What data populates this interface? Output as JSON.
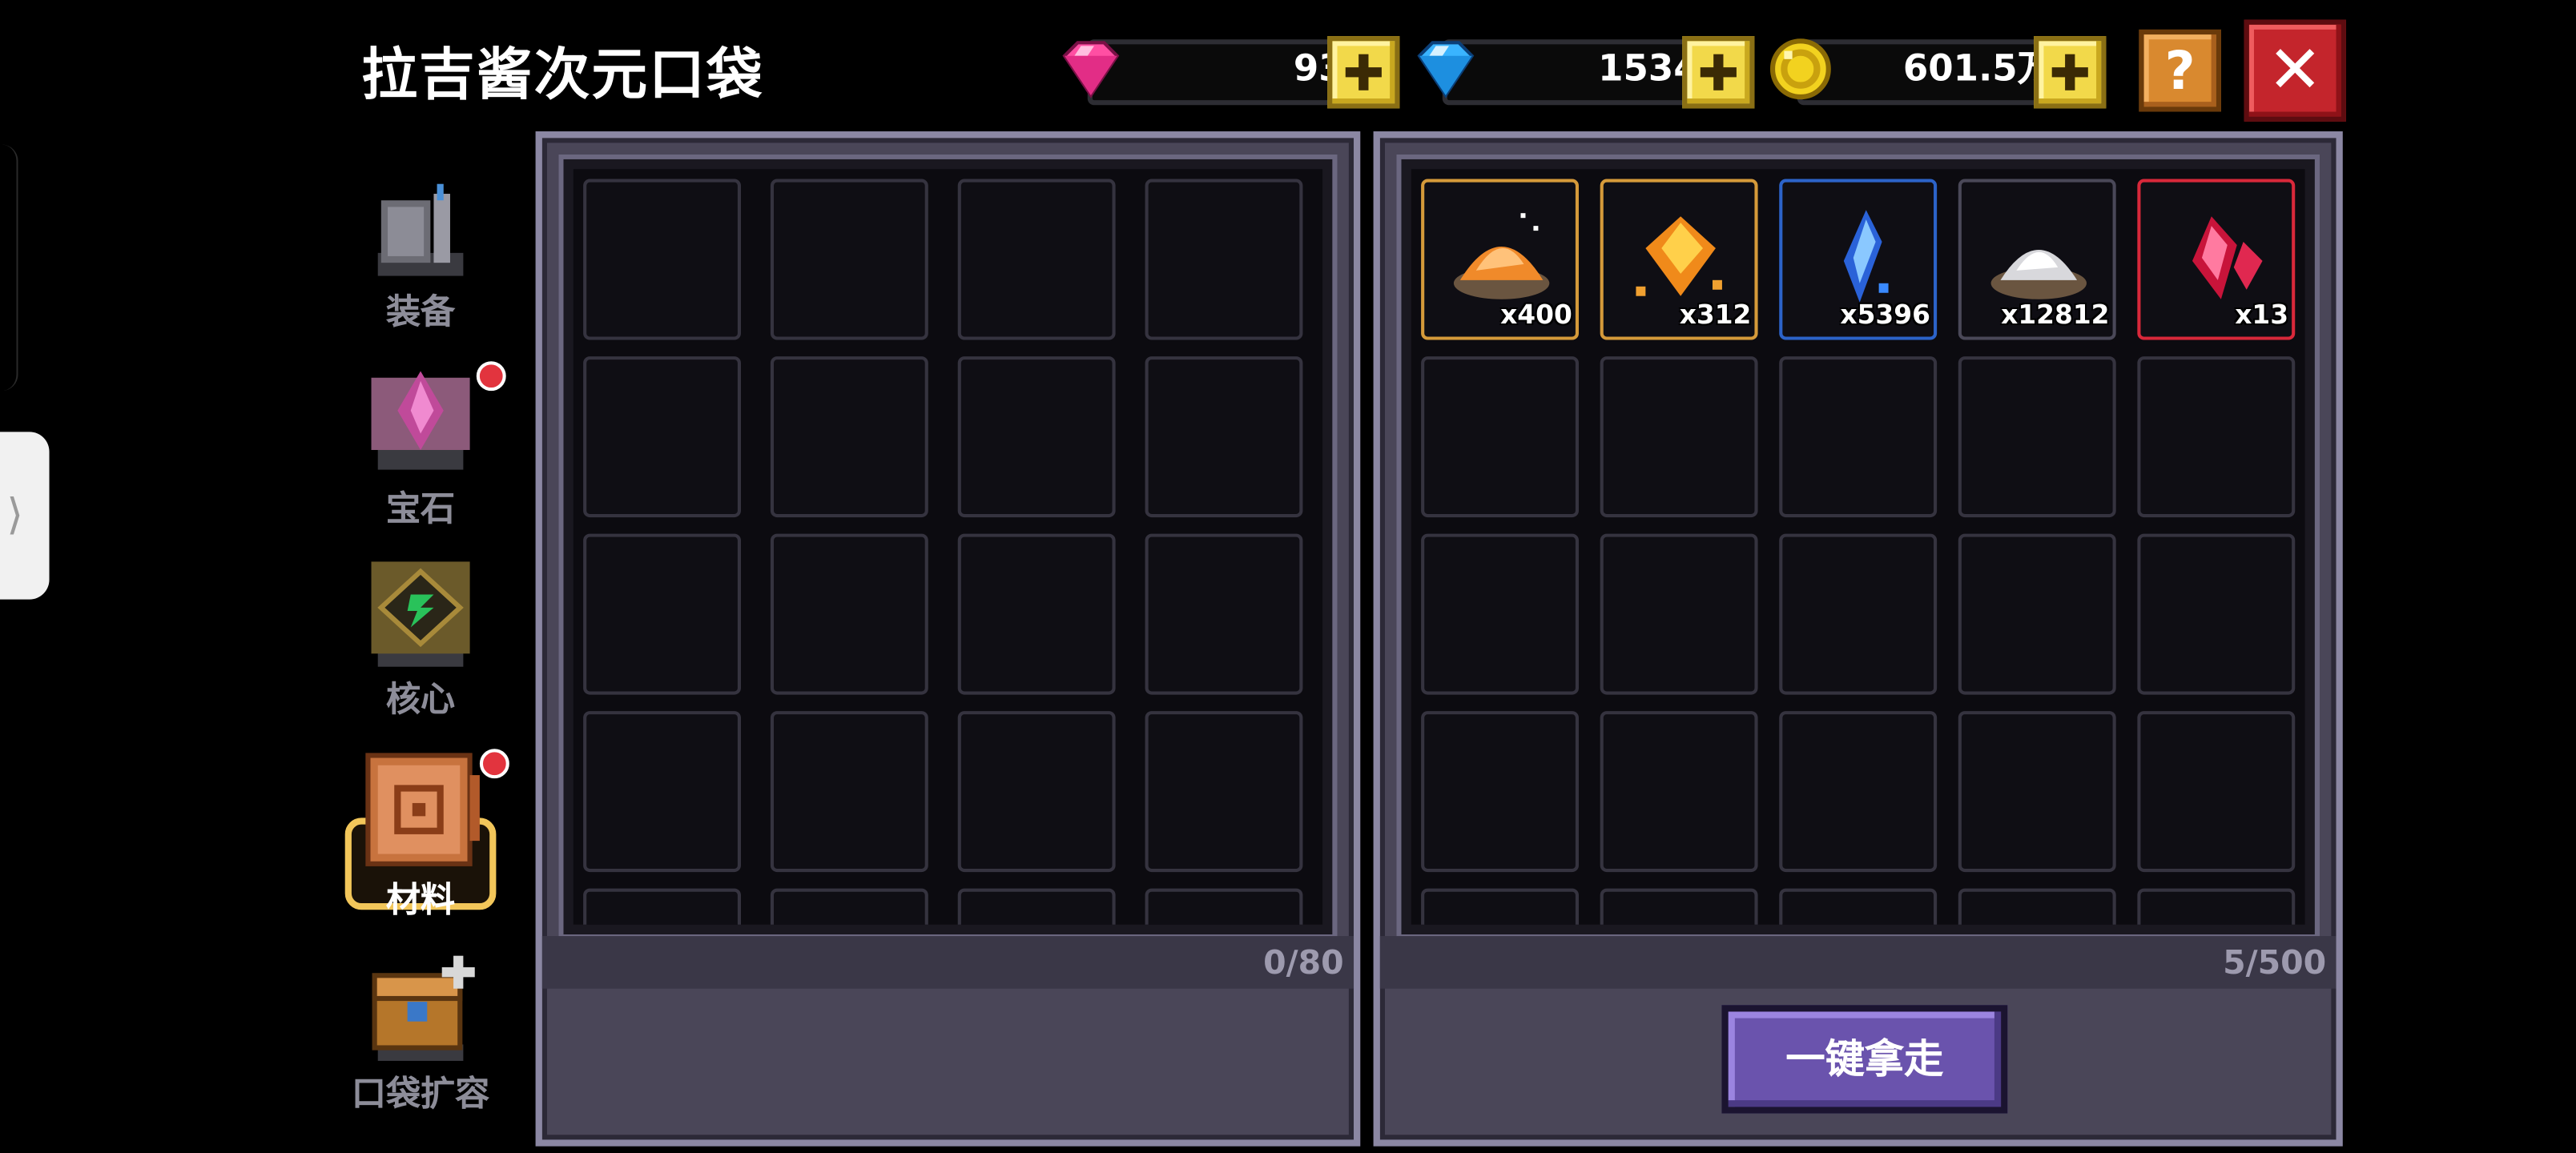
{
  "title": "拉吉酱次元口袋",
  "currencies": [
    {
      "name": "pink-gem",
      "value": "93",
      "color": "#ff4fa3"
    },
    {
      "name": "blue-gem",
      "value": "1534",
      "color": "#3ab4ff"
    },
    {
      "name": "gold-coin",
      "value": "601.5万",
      "color": "#f2d21f"
    }
  ],
  "buttons": {
    "help": "?",
    "close": "✕",
    "take_all": "一键拿走"
  },
  "sidebar": {
    "items": [
      {
        "label": "装备",
        "icon": "armor-icon",
        "badge": false,
        "active": false
      },
      {
        "label": "宝石",
        "icon": "gem-icon",
        "badge": true,
        "active": false
      },
      {
        "label": "核心",
        "icon": "core-icon",
        "badge": false,
        "active": false
      },
      {
        "label": "材料",
        "icon": "material-book-icon",
        "badge": true,
        "active": true
      },
      {
        "label": "口袋扩容",
        "icon": "chest-expand-icon",
        "badge": false,
        "active": false
      }
    ]
  },
  "left_panel": {
    "capacity": "0/80"
  },
  "right_panel": {
    "capacity": "5/500",
    "items": [
      {
        "name": "orange-powder",
        "qty": "x400",
        "rarity": "gold"
      },
      {
        "name": "amber-crystal",
        "qty": "x312",
        "rarity": "gold"
      },
      {
        "name": "blue-crystal",
        "qty": "x5396",
        "rarity": "blue"
      },
      {
        "name": "silver-powder",
        "qty": "x12812",
        "rarity": "grey"
      },
      {
        "name": "red-crystal",
        "qty": "x13",
        "rarity": "red"
      }
    ]
  },
  "edge_handle": "⟩"
}
